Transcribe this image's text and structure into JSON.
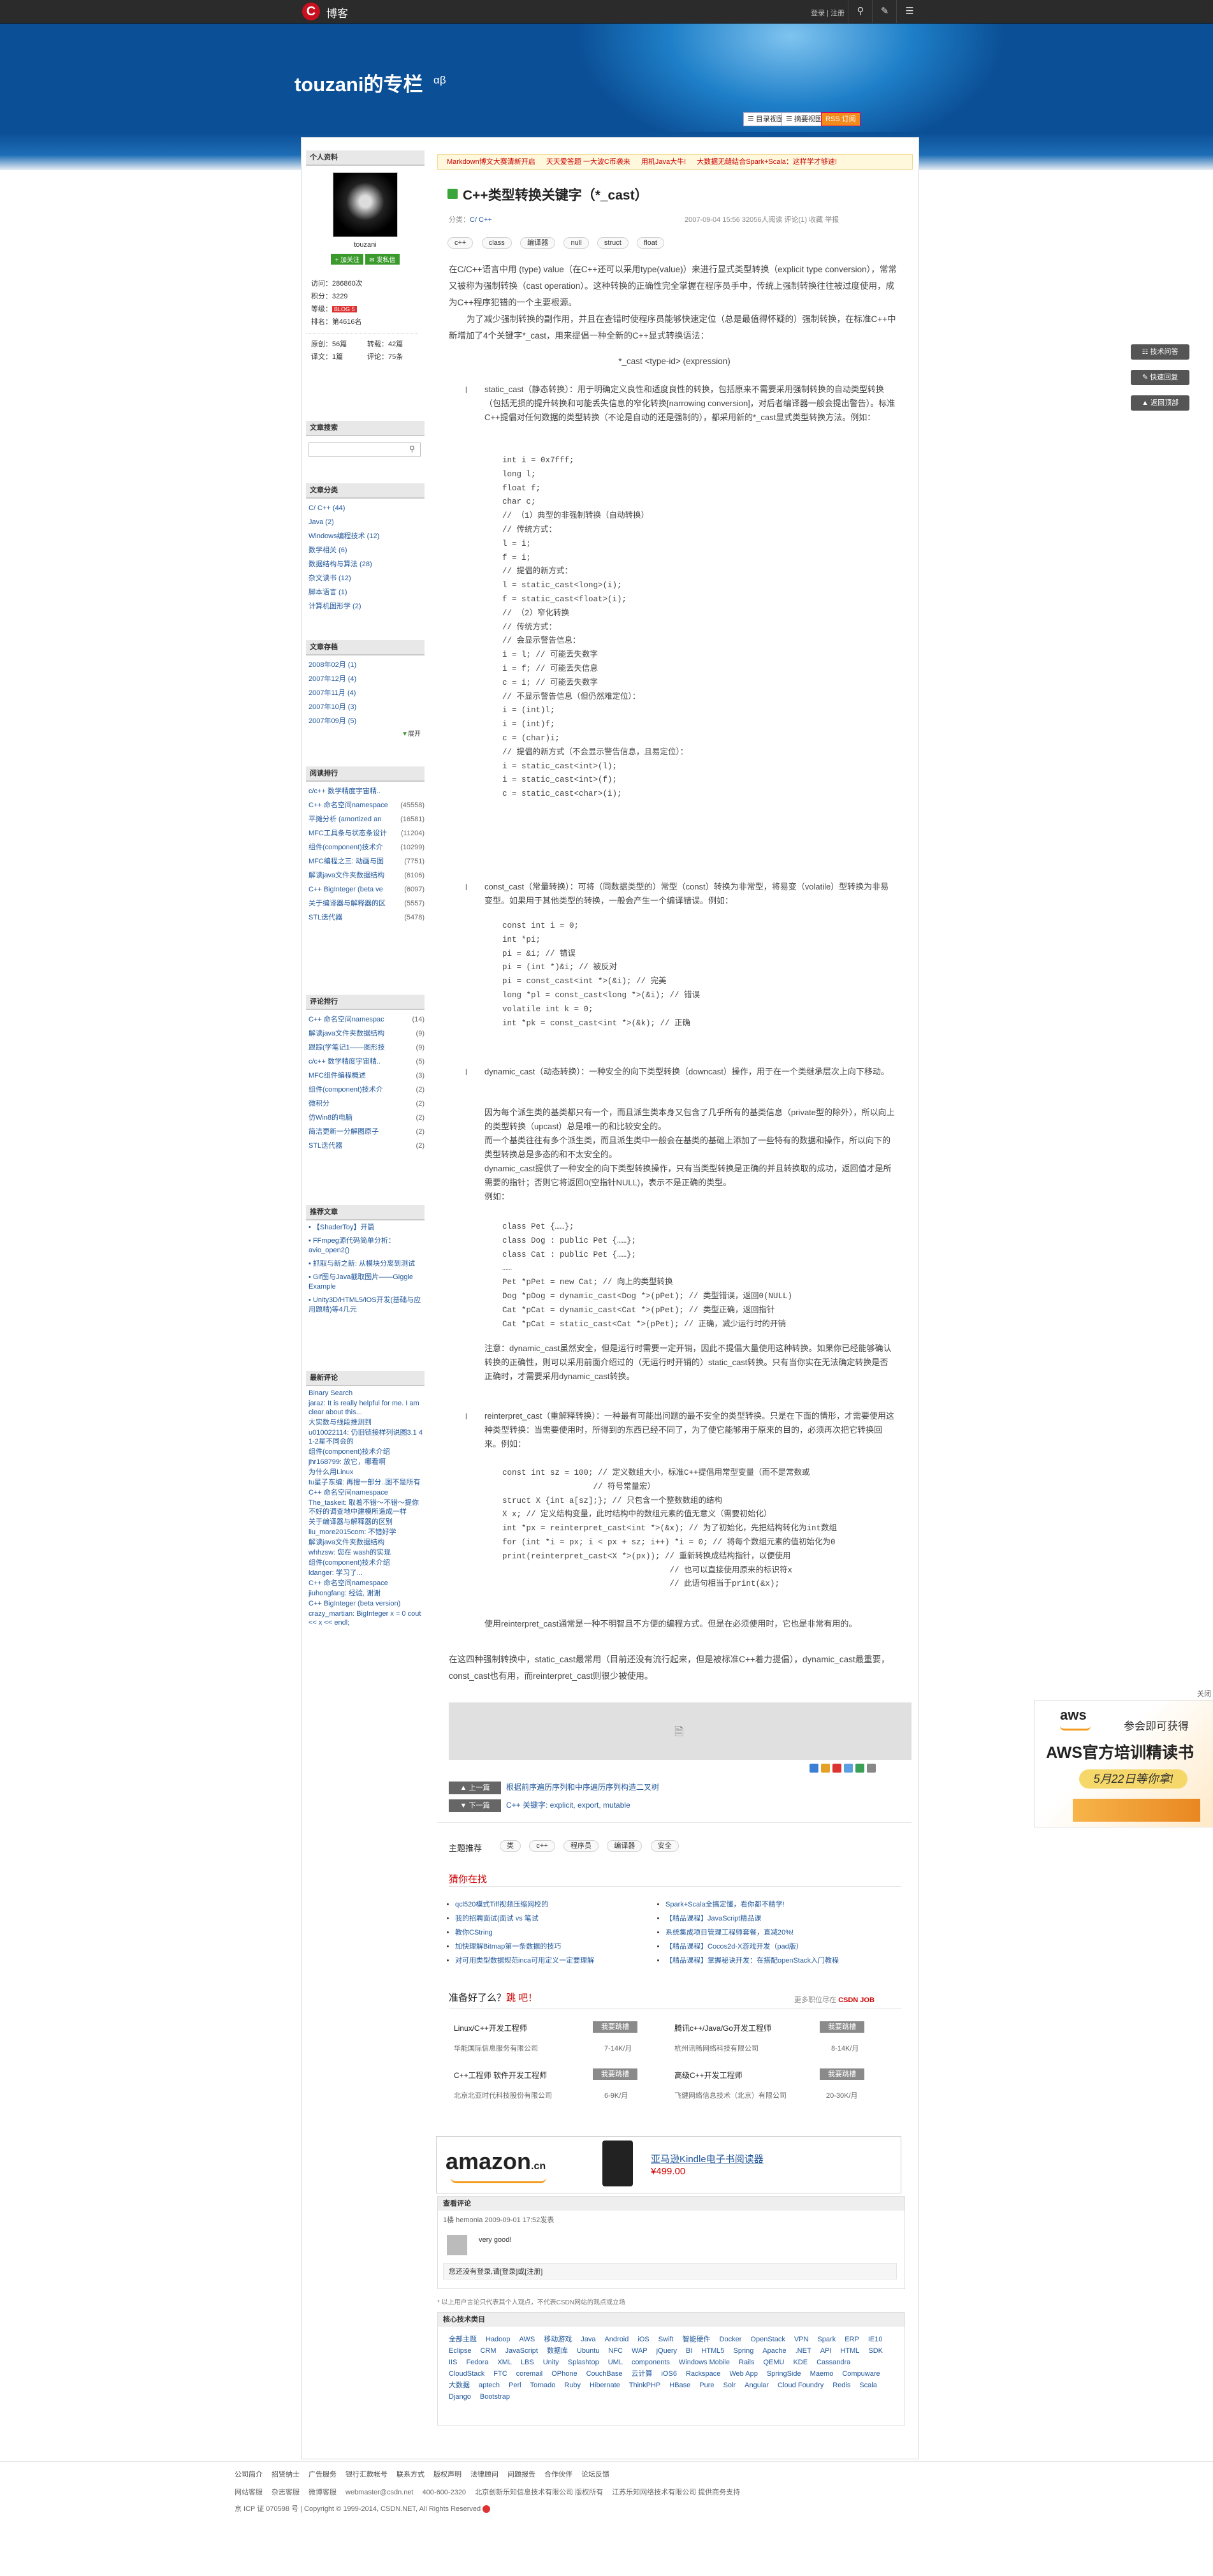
{
  "topbar": {
    "logo_letter": "C",
    "logo_text": "博客",
    "links": "登录 | 注册",
    "icons": [
      "search-icon",
      "edit-icon",
      "menu-icon"
    ]
  },
  "blog": {
    "title": "touzani的专栏",
    "subtitle": "αβ",
    "view_buttons": [
      "目录视图",
      "摘要视图",
      "订阅"
    ]
  },
  "notice": [
    "Markdown博文大赛清新开启",
    "天天爱答题 一大波C币袭来",
    "用机Java大牛!",
    "大数据无缝结合Spark+Scala：这样学才够速!"
  ],
  "profile": {
    "header": "个人资料",
    "name": "touzani",
    "follow": "加关注",
    "message": "发私信",
    "stats": [
      {
        "k": "访问",
        "v": "286860次"
      },
      {
        "k": "积分",
        "v": "3229"
      },
      {
        "k": "等级",
        "v": "BLOG 5"
      },
      {
        "k": "排名",
        "v": "第4616名"
      }
    ],
    "counts": [
      {
        "k": "原创",
        "v": "56篇"
      },
      {
        "k": "转载",
        "v": "42篇"
      },
      {
        "k": "译文",
        "v": "1篇"
      },
      {
        "k": "评论",
        "v": "75条"
      }
    ]
  },
  "search": {
    "header": "文章搜索",
    "placeholder": ""
  },
  "categories": {
    "header": "文章分类",
    "items": [
      "C/ C++ (44)",
      "Java (2)",
      "Windows编程技术 (12)",
      "数学相关 (6)",
      "数据结构与算法 (28)",
      "杂文读书 (12)",
      "脚本语言 (1)",
      "计算机图形学 (2)"
    ]
  },
  "archive": {
    "header": "文章存档",
    "items": [
      "2008年02月 (1)",
      "2007年12月 (4)",
      "2007年11月 (4)",
      "2007年10月 (3)",
      "2007年09月 (5)"
    ],
    "more": "展开"
  },
  "popular": {
    "header": "阅读排行",
    "items": [
      {
        "t": "c/c++ 数学精度宇宙精..",
        "c": ""
      },
      {
        "t": "C++ 命名空间namespace",
        "c": "(45558)"
      },
      {
        "t": "平摊分析 (amortized an",
        "c": "(16581)"
      },
      {
        "t": "MFC工具条与状态条设计",
        "c": "(11204)"
      },
      {
        "t": "组件(component)技术介",
        "c": "(10299)"
      },
      {
        "t": "MFC编程之三: 动画与图",
        "c": "(7751)"
      },
      {
        "t": "解读java文件夹数据结构",
        "c": "(6106)"
      },
      {
        "t": "C++ BigInteger (beta ve",
        "c": "(6097)"
      },
      {
        "t": "关于编译器与解释器的区",
        "c": "(5557)"
      },
      {
        "t": "STL迭代器",
        "c": "(5478)"
      }
    ]
  },
  "comments_rank": {
    "header": "评论排行",
    "items": [
      {
        "t": "C++ 命名空间namespac",
        "c": "(14)"
      },
      {
        "t": "解读java文件夹数据结构",
        "c": "(9)"
      },
      {
        "t": "跟踪(学笔记1——图形技",
        "c": "(9)"
      },
      {
        "t": "c/c++ 数学精度宇宙精..",
        "c": "(5)"
      },
      {
        "t": "MFC组件编程概述",
        "c": "(3)"
      },
      {
        "t": "组件(component)技术介",
        "c": "(2)"
      },
      {
        "t": "微积分",
        "c": "(2)"
      },
      {
        "t": "仿Win8的电脑",
        "c": "(2)"
      },
      {
        "t": "简洁更新一分解图原子",
        "c": "(2)"
      },
      {
        "t": "STL迭代器",
        "c": "(2)"
      }
    ]
  },
  "recommend": {
    "header": "推荐文章",
    "items": [
      "【ShaderToy】开篇",
      "FFmpeg源代码简单分析：avio_open2()",
      "抓取与新之新: 从模块分离到测试",
      "Gif图与Java截取图片——Giggle Example",
      "Unity3D/HTML5/iOS开发(基础与应用题精)等4几元"
    ]
  },
  "latest_comments": {
    "header": "最新评论",
    "items": [
      "Binary Search",
      "jaraz: It is really helpful for me. I am clear about this...",
      "大实数与线段推测到",
      "u010022114: 仍旧链接样列说图3.1 4 1-2星不同会的",
      "组件(component)技术介绍",
      "jhr168799: 放它，哪看啊",
      "为什么用Linux",
      "tu星子东编: 再搜一部分..图不是所有",
      "C++ 命名空间namespace",
      "The_taskeit: 取着不错～不错～提你不好的调查地中建模所造成一样",
      "关于编译器与解释器的区别",
      "liu_more2015com: 不错好学",
      "解读java文件夹数据结构",
      "whhzsw: 您在 wash的实现",
      "组件(component)技术介绍",
      "ldanger: 学习了...",
      "C++ 命名空间namespace",
      "jiuhongfang: 经验, 谢谢",
      "C++ BigInteger (beta version)",
      "crazy_martian: BigInteger x = 0 cout << x << endl;"
    ]
  },
  "article": {
    "title": "C++类型转换关键字（*_cast）",
    "category_label": "分类：",
    "category": "C/ C++",
    "meta_right": "2007-09-04 15:56   32056人阅读   评论(1)   收藏   举报",
    "tags": [
      "c++",
      "class",
      "编译器",
      "null",
      "struct",
      "float"
    ],
    "intro": "在C/C++语言中用 (type) value（在C++还可以采用type(value)）来进行显式类型转换（explicit type conversion），常常又被称为强制转换（cast operation）。这种转换的正确性完全掌握在程序员手中，传统上强制转换往往被过度使用，成为C++程序犯错的一个主要根源。",
    "intro2": "为了减少强制转换的副作用，并且在查错时使程序员能够快速定位（总是最值得怀疑的）强制转换，在标准C++中新增加了4个关键字*_cast，用来提倡一种全新的C++显式转换语法：",
    "syntax": "*_cast <type-id> (expression)",
    "s1": "static_cast（静态转换）：用于明确定义良性和适度良性的转换，包括原来不需要采用强制转换的自动类型转换（包括无损的提升转换和可能丢失信息的窄化转换[narrowing conversion]，对后者编译器一般会提出警告）。标准C++提倡对任何数据的类型转换（不论是自动的还是强制的），都采用新的*_cast显式类型转换方法。例如：",
    "code1": "int i = 0x7fff;\nlong l;\nfloat f;\nchar c;\n// （1）典型的非强制转换（自动转换）\n// 传统方式：\nl = i;\nf = i;\n// 提倡的新方式：\nl = static_cast<long>(i);\nf = static_cast<float>(i);\n// （2）窄化转换\n// 传统方式：\n// 会显示警告信息：\ni = l; // 可能丢失数字\ni = f; // 可能丢失信息\nc = i; // 可能丢失数字\n// 不显示警告信息（但仍然难定位）：\ni = (int)l;\ni = (int)f;\nc = (char)i;\n// 提倡的新方式（不会显示警告信息，且易定位）：\ni = static_cast<int>(l);\ni = static_cast<int>(f);\nc = static_cast<char>(i);",
    "s2": "const_cast（常量转换）：可将（同数据类型的）常型（const）转换为非常型，将易变（volatile）型转换为非易变型。如果用于其他类型的转换，一般会产生一个编译错误。例如：",
    "code2": "const int i = 0;\nint *pi;\npi = &i; // 错误\npi = (int *)&i; // 被反对\npi = const_cast<int *>(&i); // 完美\nlong *pl = const_cast<long *>(&i); // 错误\nvolatile int k = 0;\nint *pk = const_cast<int *>(&k); // 正确",
    "s3": "dynamic_cast（动态转换）：一种安全的向下类型转换（downcast）操作，用于在一个类继承层次上向下移动。",
    "s3b": "因为每个派生类的基类都只有一个，而且派生类本身又包含了几乎所有的基类信息（private型的除外），所以向上的类型转换（upcast）总是唯一的和比较安全的。\n而一个基类往往有多个派生类，而且派生类中一般会在基类的基础上添加了一些特有的数据和操作，所以向下的类型转换总是多态的和不太安全的。\ndynamic_cast提供了一种安全的向下类型转换操作，只有当类型转换是正确的并且转换取的成功，返回值才是所需要的指针；否则它将返回0(空指针NULL)，表示不是正确的类型。\n例如：",
    "code3": "class Pet {……};\nclass Dog : public Pet {……};\nclass Cat : public Pet {……};\n……\nPet *pPet = new Cat; // 向上的类型转换\nDog *pDog = dynamic_cast<Dog *>(pPet); // 类型错误，返回0(NULL)\nCat *pCat = dynamic_cast<Cat *>(pPet); // 类型正确，返回指针\nCat *pCat = static_cast<Cat *>(pPet); // 正确，减少运行时的开销",
    "s3c": "注意：dynamic_cast虽然安全，但是运行时需要一定开销，因此不提倡大量使用这种转换。如果你已经能够确认转换的正确性，则可以采用前面介绍过的（无运行时开销的）static_cast转换。只有当你实在无法确定转换是否正确时，才需要采用dynamic_cast转换。",
    "s4": "reinterpret_cast（重解释转换）：一种最有可能出问题的最不安全的类型转换。只是在下面的情形，才需要使用这种类型转换：当需要使用时，所得到的东西已经不同了，为了使它能够用于原来的目的，必须再次把它转换回来。例如：",
    "code4": "const int sz = 100; // 定义数组大小，标准C++提倡用常型变量（而不是常数或\n                   // 符号常量宏）\nstruct X {int a[sz];}; // 只包含一个整数数组的结构\nX x; // 定义结构变量，此时结构中的数组元素的值无意义（需要初始化）\nint *px = reinterpret_cast<int *>(&x); // 为了初始化，先把结构转化为int数组\nfor (int *i = px; i < px + sz; i++) *i = 0; // 将每个数组元素的值初始化为0\nprint(reinterpret_cast<X *>(px)); // 重新转换成结构指针，以便使用\n                                   // 也可以直接使用原来的标识符x\n                                   // 此语句相当于print(&x);",
    "s4b": "使用reinterpret_cast通常是一种不明智且不方便的编程方式。但是在必须使用时，它也是非常有用的。",
    "outro": "在这四种强制转换中，static_cast最常用（目前还没有流行起来，但是被标准C++着力提倡），dynamic_cast最重要，const_cast也有用，而reinterpret_cast则很少被使用。"
  },
  "prevnext": {
    "prev_btn": "上一篇",
    "prev": "根据前序遍历序列和中序遍历序列构造二叉树",
    "next_btn": "下一篇",
    "next": "C++ 关键字: explicit, export, mutable"
  },
  "topics": {
    "label": "主题推荐",
    "items": [
      "类",
      "c++",
      "程序员",
      "编译器",
      "安全"
    ]
  },
  "guess": {
    "label": "猜你在找",
    "left": [
      "qcl520模式Tiff视频压缩网校的",
      "我的招聘面试(面试 vs 笔试",
      "教你CString",
      "加快理解Bitmap第一条数据的技巧",
      "对可用类型数据规范inca可用定义一定要理解"
    ],
    "right": [
      "Spark+Scala全搞定懂，看你都不精学!",
      "【精品课程】JavaScript精品课",
      "系统集成项目管理工程师套餐，直减20%!",
      "【精品课程】Cocos2d-X游戏开发（pad版）",
      "【精品课程】掌握秘诀开发：在搭配openStack入门教程"
    ]
  },
  "jobs": {
    "label": "准备好了么？",
    "label2": "跳 吧！",
    "more": "更多职位尽在",
    "more_brand": "CSDN JOB",
    "apply": "我要跳槽",
    "items": [
      {
        "t": "Linux/C++开发工程师",
        "c": "华能国际信息服务有限公司",
        "s": "7-14K/月"
      },
      {
        "t": "腾讯c++/Java/Go开发工程师",
        "c": "杭州讯畅网络科技有限公司",
        "s": "8-14K/月"
      },
      {
        "t": "C++工程师 软件开发工程师",
        "c": "北京北亚时代科技股份有限公司",
        "s": "6-9K/月"
      },
      {
        "t": "高级C++开发工程师",
        "c": "飞健网络信息技术（北京）有限公司",
        "s": "20-30K/月"
      }
    ]
  },
  "ad_amazon": {
    "brand": "amazon",
    "brand_suffix": ".cn",
    "line": "亚马逊Kindle电子书阅读器",
    "price": "¥499.00"
  },
  "comments": {
    "header": "查看评论",
    "entry_meta": "1楼 hemonia 2009-09-01 17:52发表",
    "entry_text": "very good!",
    "login_hint": "您还没有登录,请[登录]或[注册]",
    "disclaimer": "* 以上用户言论只代表其个人观点，不代表CSDN网站的观点或立场"
  },
  "core": {
    "header": "核心技术类目",
    "tags": [
      "全部主题",
      "Hadoop",
      "AWS",
      "移动游戏",
      "Java",
      "Android",
      "iOS",
      "Swift",
      "智能硬件",
      "Docker",
      "OpenStack",
      "VPN",
      "Spark",
      "ERP",
      "IE10",
      "Eclipse",
      "CRM",
      "JavaScript",
      "数据库",
      "Ubuntu",
      "NFC",
      "WAP",
      "jQuery",
      "BI",
      "HTML5",
      "Spring",
      "Apache",
      ".NET",
      "API",
      "HTML",
      "SDK",
      "IIS",
      "Fedora",
      "XML",
      "LBS",
      "Unity",
      "Splashtop",
      "UML",
      "components",
      "Windows Mobile",
      "Rails",
      "QEMU",
      "KDE",
      "Cassandra",
      "CloudStack",
      "FTC",
      "coremail",
      "OPhone",
      "CouchBase",
      "云计算",
      "iOS6",
      "Rackspace",
      "Web App",
      "SpringSide",
      "Maemo",
      "Compuware",
      "大数据",
      "aptech",
      "Perl",
      "Tornado",
      "Ruby",
      "Hibernate",
      "ThinkPHP",
      "HBase",
      "Pure",
      "Solr",
      "Angular",
      "Cloud Foundry",
      "Redis",
      "Scala",
      "Django",
      "Bootstrap"
    ]
  },
  "float_btns": [
    "技术问答",
    "快速回复",
    "返回顶部"
  ],
  "aws_ad": {
    "close": "关闭",
    "brand": "aws",
    "line1": "参会即可获得",
    "line2": "AWS官方培训精读书",
    "date": "5月22日等你拿!"
  },
  "footer": {
    "links": [
      "公司简介",
      "招贤纳士",
      "广告服务",
      "银行汇款帐号",
      "联系方式",
      "版权声明",
      "法律顾问",
      "问题报告",
      "合作伙伴",
      "论坛反馈"
    ],
    "contact": [
      "网站客服",
      "杂志客服",
      "微博客服",
      "webmaster@csdn.net",
      "400-600-2320",
      "北京创新乐知信息技术有限公司 版权所有",
      "江苏乐知网络技术有限公司 提供商务支持"
    ],
    "copyright": "京 ICP 证 070598 号  |  Copyright © 1999-2014, CSDN.NET, All Rights Reserved"
  },
  "colors": {
    "banner": "#0b4f96",
    "accent_red": "#c8101e",
    "topbar": "#2b2b2b"
  }
}
